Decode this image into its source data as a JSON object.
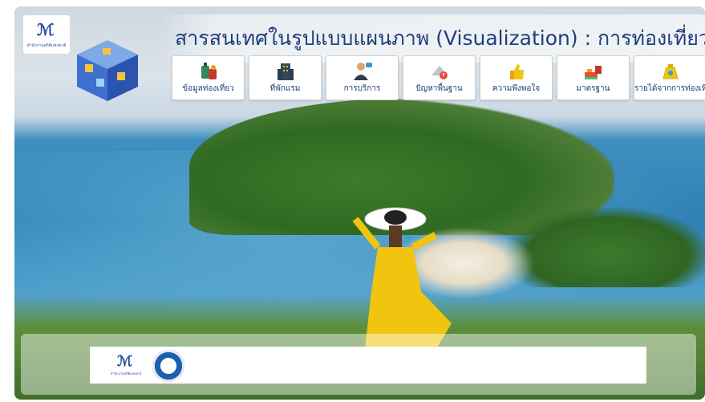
{
  "header": {
    "title": "สารสนเทศในรูปแบบแผนภาพ (Visualization) : การท่องเที่ยว",
    "logo_caption": "สำนักงานสถิติแห่งชาติ"
  },
  "nav": {
    "items": [
      {
        "label": "ข้อมูลท่องเที่ยว",
        "icon": "luggage-icon"
      },
      {
        "label": "ที่พักแรม",
        "icon": "hotel-icon"
      },
      {
        "label": "การบริการ",
        "icon": "service-staff-icon"
      },
      {
        "label": "ปัญหาพื้นฐาน",
        "icon": "problem-warning-icon"
      },
      {
        "label": "ความพึงพอใจ",
        "icon": "thumbs-up-icon"
      },
      {
        "label": "มาตรฐาน",
        "icon": "standard-cup-icon"
      },
      {
        "label": "รายได้จากการท่องเที่ยว",
        "icon": "money-bag-icon"
      }
    ]
  },
  "footer": {
    "logo_caption": "สำนักงานสถิติแห่งชาติ"
  },
  "colors": {
    "title": "#1f3e7a",
    "accent_blue": "#2b4fa0",
    "sea": "#2f7fb4",
    "foliage": "#3f6e2a"
  }
}
